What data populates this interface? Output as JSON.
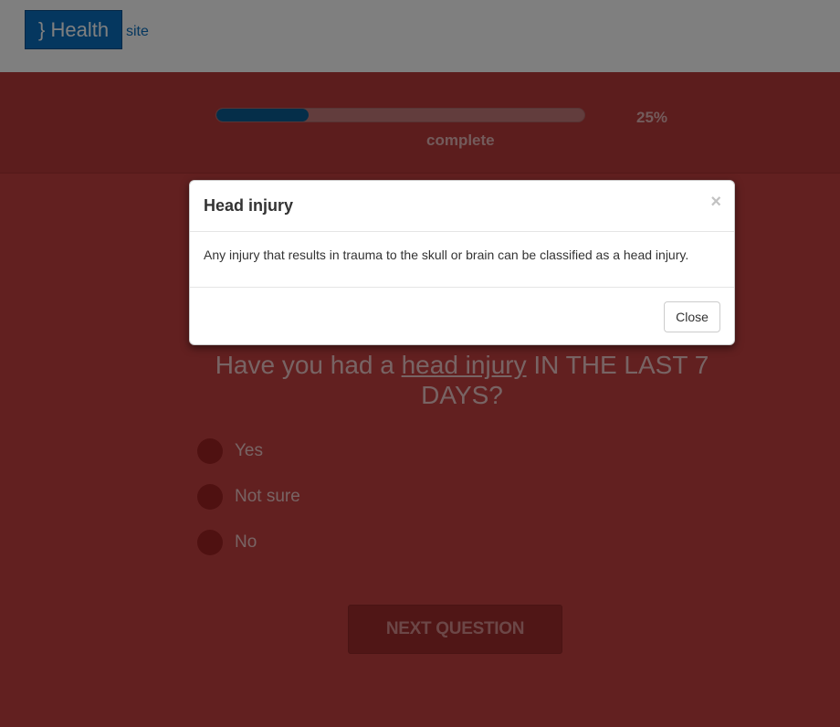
{
  "header": {
    "logo_mark": "}",
    "logo_text": "Health",
    "logo_suffix": "site"
  },
  "progress": {
    "percent_value": 25,
    "percent_label": "25%",
    "caption": "complete"
  },
  "question": {
    "prefix": "Have you had a ",
    "link_text": "head injury",
    "suffix": " IN THE LAST 7 DAYS?"
  },
  "options": [
    {
      "label": "Yes"
    },
    {
      "label": "Not sure"
    },
    {
      "label": "No"
    }
  ],
  "next_button": {
    "label": "NEXT QUESTION"
  },
  "modal": {
    "title": "Head injury",
    "close_x": "×",
    "body": "Any injury that results in trauma to the skull or brain can be classified as a head injury.",
    "close_button": "Close"
  },
  "colors": {
    "brand_blue": "#0a6fbf",
    "progress_fill": "#0b5c92",
    "page_red": "#c74242"
  }
}
